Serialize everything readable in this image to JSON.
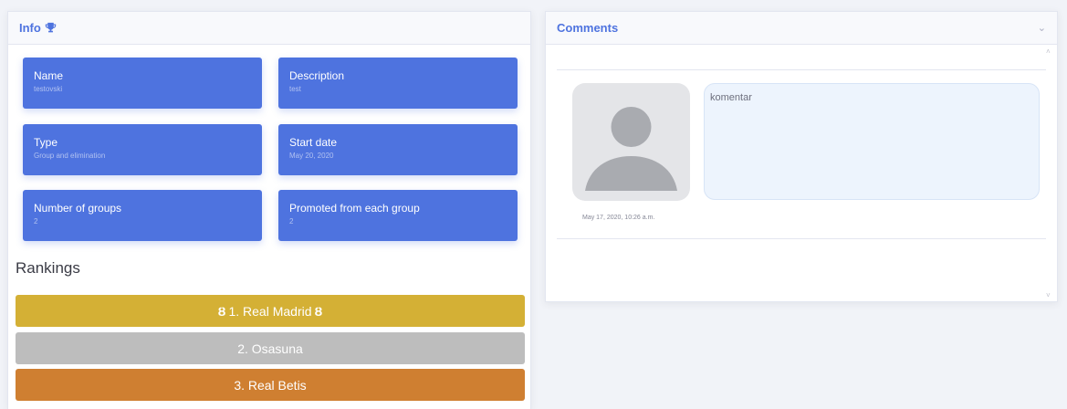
{
  "info": {
    "title": "Info",
    "title_icon": "trophy-icon",
    "fields": [
      {
        "label": "Name",
        "value": "testovski"
      },
      {
        "label": "Description",
        "value": "test"
      },
      {
        "label": "Type",
        "value": "Group and elimination"
      },
      {
        "label": "Start date",
        "value": "May 20, 2020"
      },
      {
        "label": "Number of groups",
        "value": "2"
      },
      {
        "label": "Promoted from each group",
        "value": "2"
      }
    ]
  },
  "rankings": {
    "title": "Rankings",
    "items": [
      {
        "text": "1. Real Madrid",
        "color": "#d4b035",
        "medal": "Ȣ"
      },
      {
        "text": "2. Osasuna",
        "color": "#bdbdbd"
      },
      {
        "text": "3. Real Betis",
        "color": "#cf7f31"
      }
    ]
  },
  "comments": {
    "title": "Comments",
    "header_icon": "chevron-down-icon",
    "entries": [
      {
        "text": "komentar",
        "date": "May 17, 2020, 10:26 a.m.",
        "avatar": "user-avatar-icon"
      }
    ]
  },
  "colors": {
    "accent": "#4e73df",
    "background": "#f1f3f8"
  }
}
